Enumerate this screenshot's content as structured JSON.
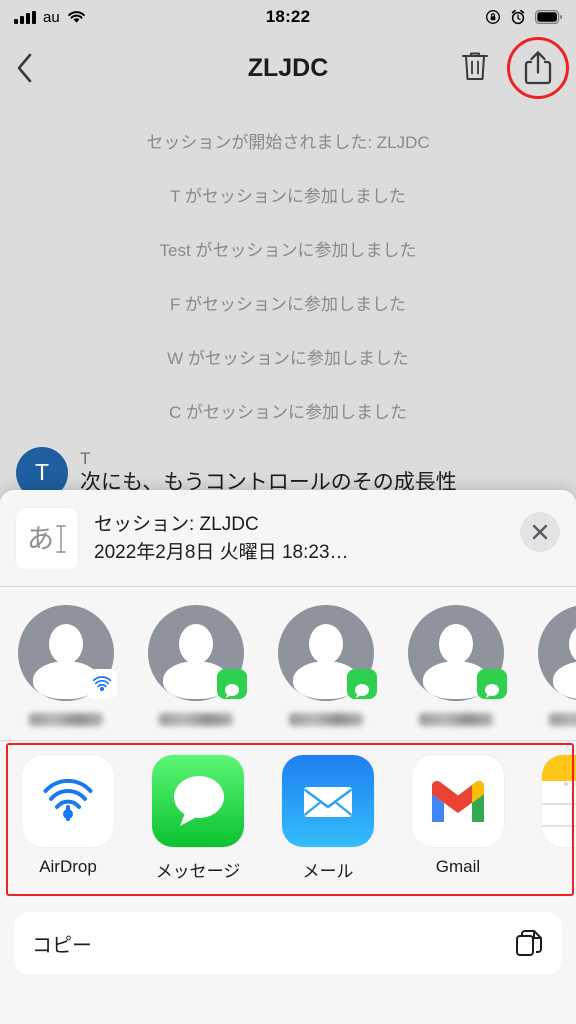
{
  "status_bar": {
    "carrier": "au",
    "time": "18:22",
    "signal_icon": "signal-bars-icon",
    "wifi_icon": "wifi-icon",
    "rotation_lock_icon": "rotation-lock-icon",
    "alarm_icon": "alarm-clock-icon",
    "battery_icon": "battery-full-icon"
  },
  "navbar": {
    "back_icon": "chevron-left-icon",
    "title": "ZLJDC",
    "delete_icon": "trash-icon",
    "share_icon": "share-upload-icon",
    "highlight_color": "#ee2222"
  },
  "chat": {
    "background_color": "#dcdcdc",
    "system_messages": [
      "セッションが開始されました: ZLJDC",
      "T がセッションに参加しました",
      "Test がセッションに参加しました",
      "F がセッションに参加しました",
      "W がセッションに参加しました",
      "C がセッションに参加しました"
    ],
    "message": {
      "avatar_initial": "T",
      "avatar_color": "#1f5fa0",
      "sender": "T",
      "text": "次にも、もうコントロールのその成長性"
    }
  },
  "share_sheet": {
    "document": {
      "thumb_glyph": "あ",
      "thumb_icon": "text-document-icon",
      "title": "セッション: ZLJDC",
      "subtitle": "2022年2月8日 火曜日 18:23…"
    },
    "close_icon": "close-icon",
    "contacts": [
      {
        "name": "",
        "badge": "airdrop-badge-icon"
      },
      {
        "name": "",
        "badge": "messages-badge-icon"
      },
      {
        "name": "",
        "badge": "messages-badge-icon"
      },
      {
        "name": "",
        "badge": "messages-badge-icon"
      },
      {
        "name": "",
        "badge": ""
      }
    ],
    "apps": [
      {
        "label": "AirDrop",
        "icon": "airdrop-icon"
      },
      {
        "label": "メッセージ",
        "icon": "messages-icon"
      },
      {
        "label": "メール",
        "icon": "mail-icon"
      },
      {
        "label": "Gmail",
        "icon": "gmail-icon"
      },
      {
        "label": "",
        "icon": "notes-icon"
      }
    ],
    "apps_highlight_color": "#ee2222",
    "actions": [
      {
        "label": "コピー",
        "icon": "copy-icon"
      }
    ]
  }
}
